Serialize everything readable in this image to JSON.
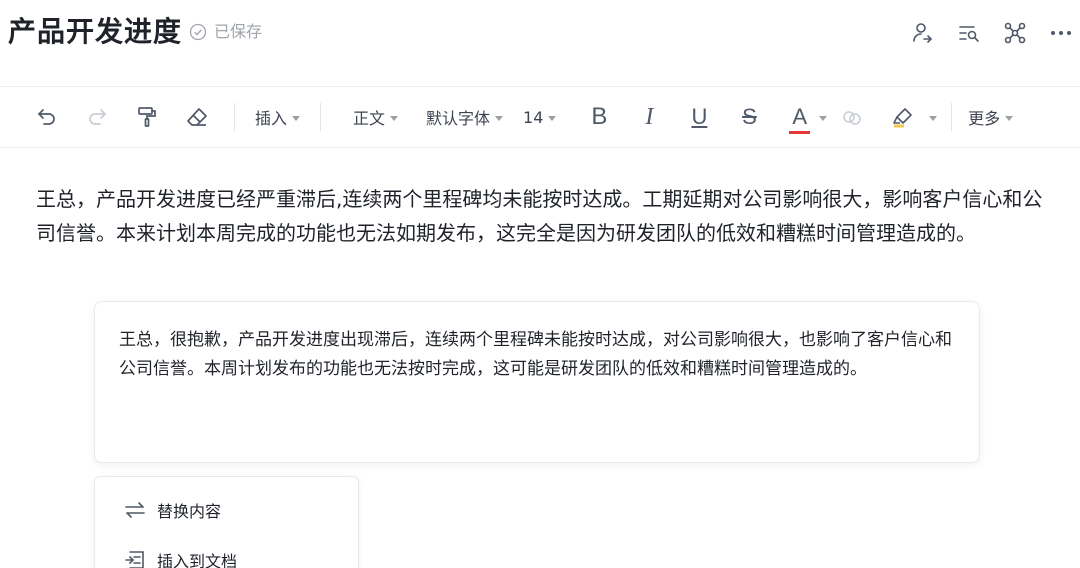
{
  "header": {
    "title": "产品开发进度",
    "saved_status": "已保存",
    "actions": [
      "share-user-icon",
      "search-list-icon",
      "graph-nodes-icon",
      "more-icon"
    ]
  },
  "toolbar": {
    "undo": "undo-icon",
    "redo": "redo-icon",
    "format_painter": "format-painter-icon",
    "clear_format": "eraser-icon",
    "insert_label": "插入",
    "paragraph_label": "正文",
    "font_label": "默认字体",
    "font_size": "14",
    "bold": "B",
    "italic": "I",
    "underline": "U",
    "strike": "S",
    "font_color_glyph": "A",
    "font_color": "#e53935",
    "more_label": "更多"
  },
  "content": {
    "original_text": "王总，产品开发进度已经严重滞后,连续两个里程碑均未能按时达成。工期延期对公司影响很大，影响客户信心和公司信誉。本来计划本周完成的功能也无法如期发布，这完全是因为研发团队的低效和糟糕时间管理造成的。"
  },
  "ai_card": {
    "suggestion_text": "王总，很抱歉，产品开发进度出现滞后，连续两个里程碑未能按时达成，对公司影响很大，也影响了客户信心和公司信誉。本周计划发布的功能也无法按时完成，这可能是研发团队的低效和糟糕时间管理造成的。"
  },
  "menu": {
    "items": [
      {
        "label": "替换内容",
        "icon": "swap-arrows-icon"
      },
      {
        "label": "插入到文档",
        "icon": "insert-doc-icon"
      }
    ]
  }
}
